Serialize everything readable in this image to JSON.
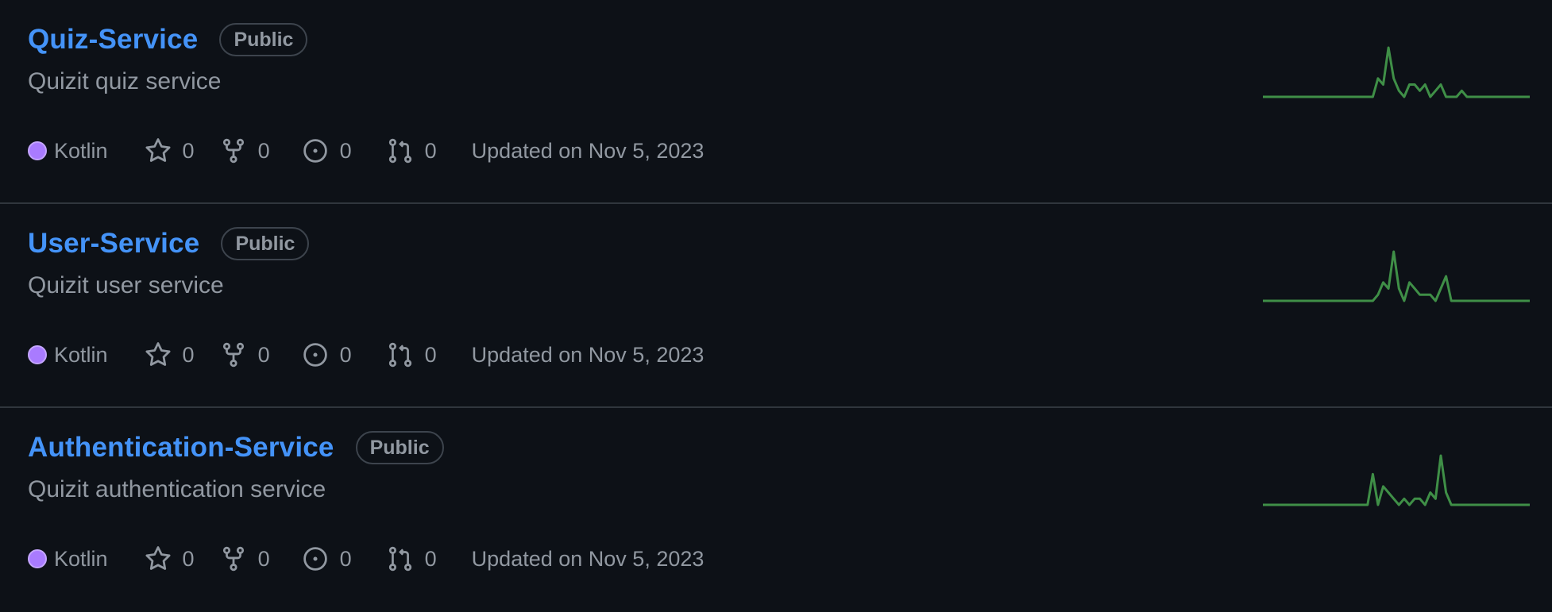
{
  "repos": [
    {
      "name": "Quiz-Service",
      "visibility": "Public",
      "description": "Quizit quiz service",
      "language": "Kotlin",
      "language_color": "#a97bff",
      "stars": "0",
      "forks": "0",
      "issues": "0",
      "pull_requests": "0",
      "updated": "Updated on Nov 5, 2023",
      "activity": [
        0,
        0,
        0,
        0,
        0,
        0,
        0,
        0,
        0,
        0,
        0,
        0,
        0,
        0,
        0,
        0,
        0,
        0,
        0,
        0,
        0,
        0,
        3,
        2,
        8,
        3,
        1,
        0,
        2,
        2,
        1,
        2,
        0,
        1,
        2,
        0,
        0,
        0,
        1,
        0,
        0,
        0,
        0,
        0,
        0,
        0,
        0,
        0,
        0,
        0,
        0,
        0
      ]
    },
    {
      "name": "User-Service",
      "visibility": "Public",
      "description": "Quizit user service",
      "language": "Kotlin",
      "language_color": "#a97bff",
      "stars": "0",
      "forks": "0",
      "issues": "0",
      "pull_requests": "0",
      "updated": "Updated on Nov 5, 2023",
      "activity": [
        0,
        0,
        0,
        0,
        0,
        0,
        0,
        0,
        0,
        0,
        0,
        0,
        0,
        0,
        0,
        0,
        0,
        0,
        0,
        0,
        0,
        0,
        1,
        3,
        2,
        8,
        2,
        0,
        3,
        2,
        1,
        1,
        1,
        0,
        2,
        4,
        0,
        0,
        0,
        0,
        0,
        0,
        0,
        0,
        0,
        0,
        0,
        0,
        0,
        0,
        0,
        0
      ]
    },
    {
      "name": "Authentication-Service",
      "visibility": "Public",
      "description": "Quizit authentication service",
      "language": "Kotlin",
      "language_color": "#a97bff",
      "stars": "0",
      "forks": "0",
      "issues": "0",
      "pull_requests": "0",
      "updated": "Updated on Nov 5, 2023",
      "activity": [
        0,
        0,
        0,
        0,
        0,
        0,
        0,
        0,
        0,
        0,
        0,
        0,
        0,
        0,
        0,
        0,
        0,
        0,
        0,
        0,
        0,
        5,
        0,
        3,
        2,
        1,
        0,
        1,
        0,
        1,
        1,
        0,
        2,
        1,
        8,
        2,
        0,
        0,
        0,
        0,
        0,
        0,
        0,
        0,
        0,
        0,
        0,
        0,
        0,
        0,
        0,
        0
      ]
    }
  ]
}
